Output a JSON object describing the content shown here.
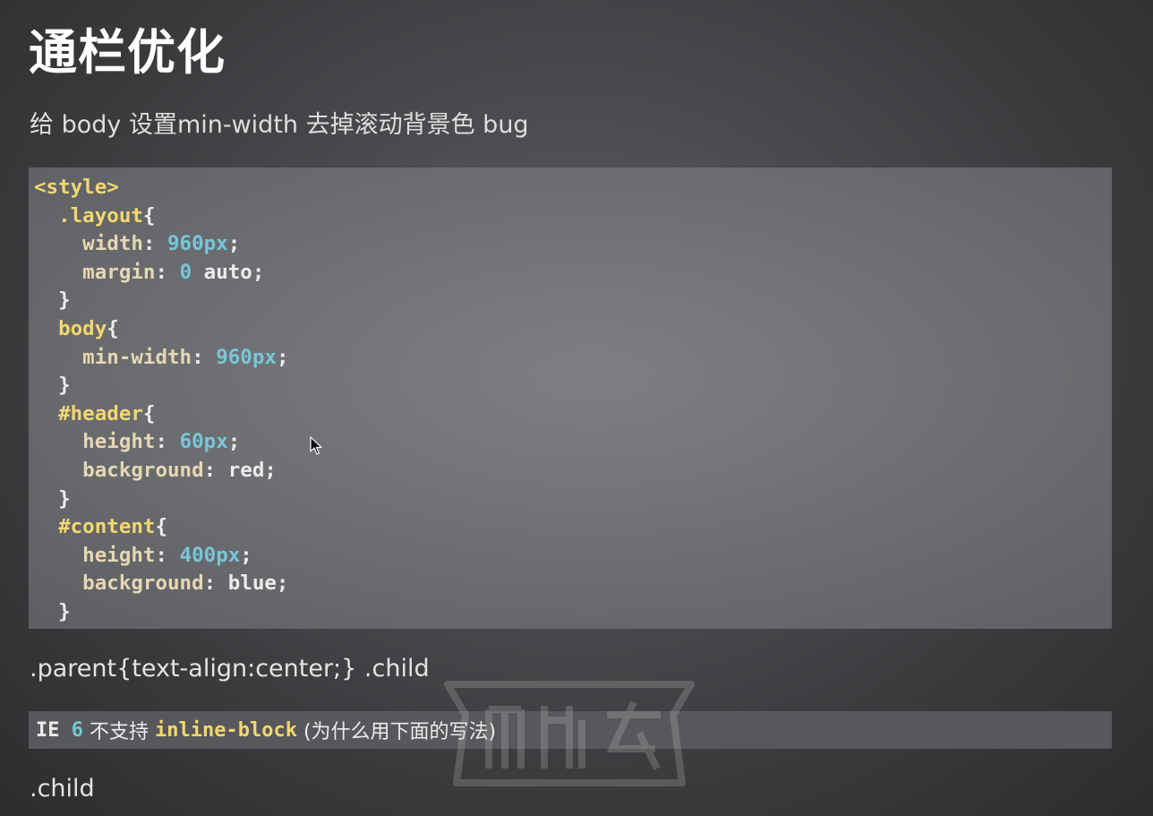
{
  "slide": {
    "title": "通栏优化",
    "subtitle": "给 body 设置min-width 去掉滚动背景色 bug"
  },
  "code": {
    "lines": [
      [
        {
          "t": "<style>",
          "c": "tag"
        }
      ],
      [
        {
          "t": "  .layout",
          "c": "sel"
        },
        {
          "t": "{",
          "c": "punct"
        }
      ],
      [
        {
          "t": "    width",
          "c": "prop"
        },
        {
          "t": ": ",
          "c": "punct"
        },
        {
          "t": "960px",
          "c": "num"
        },
        {
          "t": ";",
          "c": "punct"
        }
      ],
      [
        {
          "t": "    margin",
          "c": "prop"
        },
        {
          "t": ": ",
          "c": "punct"
        },
        {
          "t": "0",
          "c": "num"
        },
        {
          "t": " auto;",
          "c": "val"
        }
      ],
      [
        {
          "t": "  }",
          "c": "punct"
        }
      ],
      [
        {
          "t": "  body",
          "c": "sel"
        },
        {
          "t": "{",
          "c": "punct"
        }
      ],
      [
        {
          "t": "    min-width",
          "c": "prop"
        },
        {
          "t": ": ",
          "c": "punct"
        },
        {
          "t": "960px",
          "c": "num"
        },
        {
          "t": ";",
          "c": "punct"
        }
      ],
      [
        {
          "t": "  }",
          "c": "punct"
        }
      ],
      [
        {
          "t": "  #header",
          "c": "sel"
        },
        {
          "t": "{",
          "c": "punct"
        }
      ],
      [
        {
          "t": "    height",
          "c": "prop"
        },
        {
          "t": ": ",
          "c": "punct"
        },
        {
          "t": "60px",
          "c": "num"
        },
        {
          "t": ";",
          "c": "punct"
        }
      ],
      [
        {
          "t": "    background",
          "c": "prop"
        },
        {
          "t": ": ",
          "c": "punct"
        },
        {
          "t": "red;",
          "c": "val"
        }
      ],
      [
        {
          "t": "  }",
          "c": "punct"
        }
      ],
      [
        {
          "t": "  #content",
          "c": "sel"
        },
        {
          "t": "{",
          "c": "punct"
        }
      ],
      [
        {
          "t": "    height",
          "c": "prop"
        },
        {
          "t": ": ",
          "c": "punct"
        },
        {
          "t": "400px",
          "c": "num"
        },
        {
          "t": ";",
          "c": "punct"
        }
      ],
      [
        {
          "t": "    background",
          "c": "prop"
        },
        {
          "t": ": ",
          "c": "punct"
        },
        {
          "t": "blue;",
          "c": "val"
        }
      ],
      [
        {
          "t": "  }",
          "c": "punct"
        }
      ]
    ]
  },
  "text": {
    "parent_line": ".parent{text-align:center;} .child",
    "child_line": ".child"
  },
  "note": {
    "ie": "IE ",
    "six": "6",
    "no_support": " 不支持 ",
    "inline_block": "inline-block",
    "why": " (为什么用下面的写法)"
  },
  "colors": {
    "keyword": "#f3d770",
    "property": "#e6d7b4",
    "number": "#77c6d8",
    "plain": "#ececec"
  },
  "icons": {
    "cursor": "mouse-pointer-icon",
    "watermark": "watermark-logo"
  }
}
